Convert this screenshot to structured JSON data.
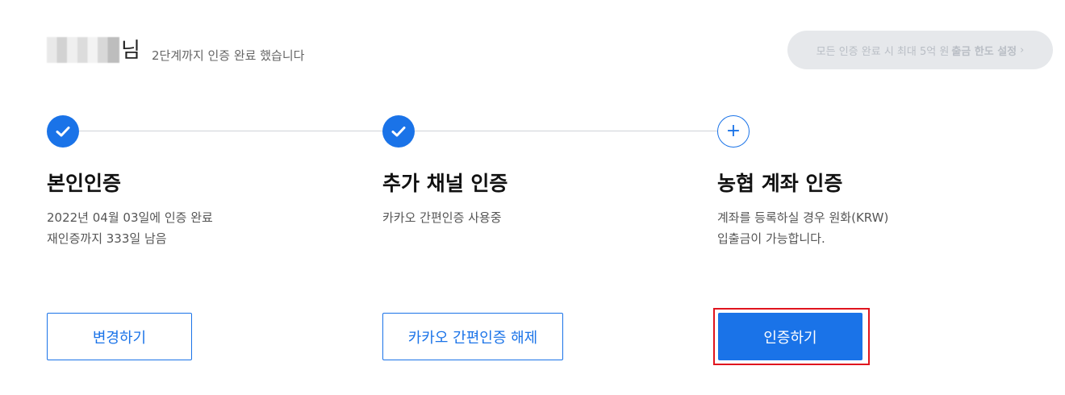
{
  "header": {
    "name_suffix": "님",
    "status_text": "2단계까지 인증 완료 했습니다"
  },
  "limit_button": {
    "prefix": "모든 인증 완료 시 최대 5억 원",
    "bold": "출금 한도 설정",
    "chevron": "›"
  },
  "steps": [
    {
      "state": "done",
      "title": "본인인증",
      "desc_line1": "2022년 04월 03일에 인증 완료",
      "desc_line2": "재인증까지 333일 남음",
      "button_label": "변경하기"
    },
    {
      "state": "done",
      "title": "추가 채널 인증",
      "desc_line1": "카카오 간편인증 사용중",
      "desc_line2": "",
      "button_label": "카카오 간편인증 해제"
    },
    {
      "state": "pending",
      "title": "농협 계좌 인증",
      "desc_line1": "계좌를 등록하실 경우 원화(KRW)",
      "desc_line2": "입출금이 가능합니다.",
      "button_label": "인증하기",
      "plus": "+"
    }
  ],
  "colors": {
    "accent": "#1a73e8",
    "highlight": "#e0141e",
    "limit_bg": "#e6e8eb"
  }
}
